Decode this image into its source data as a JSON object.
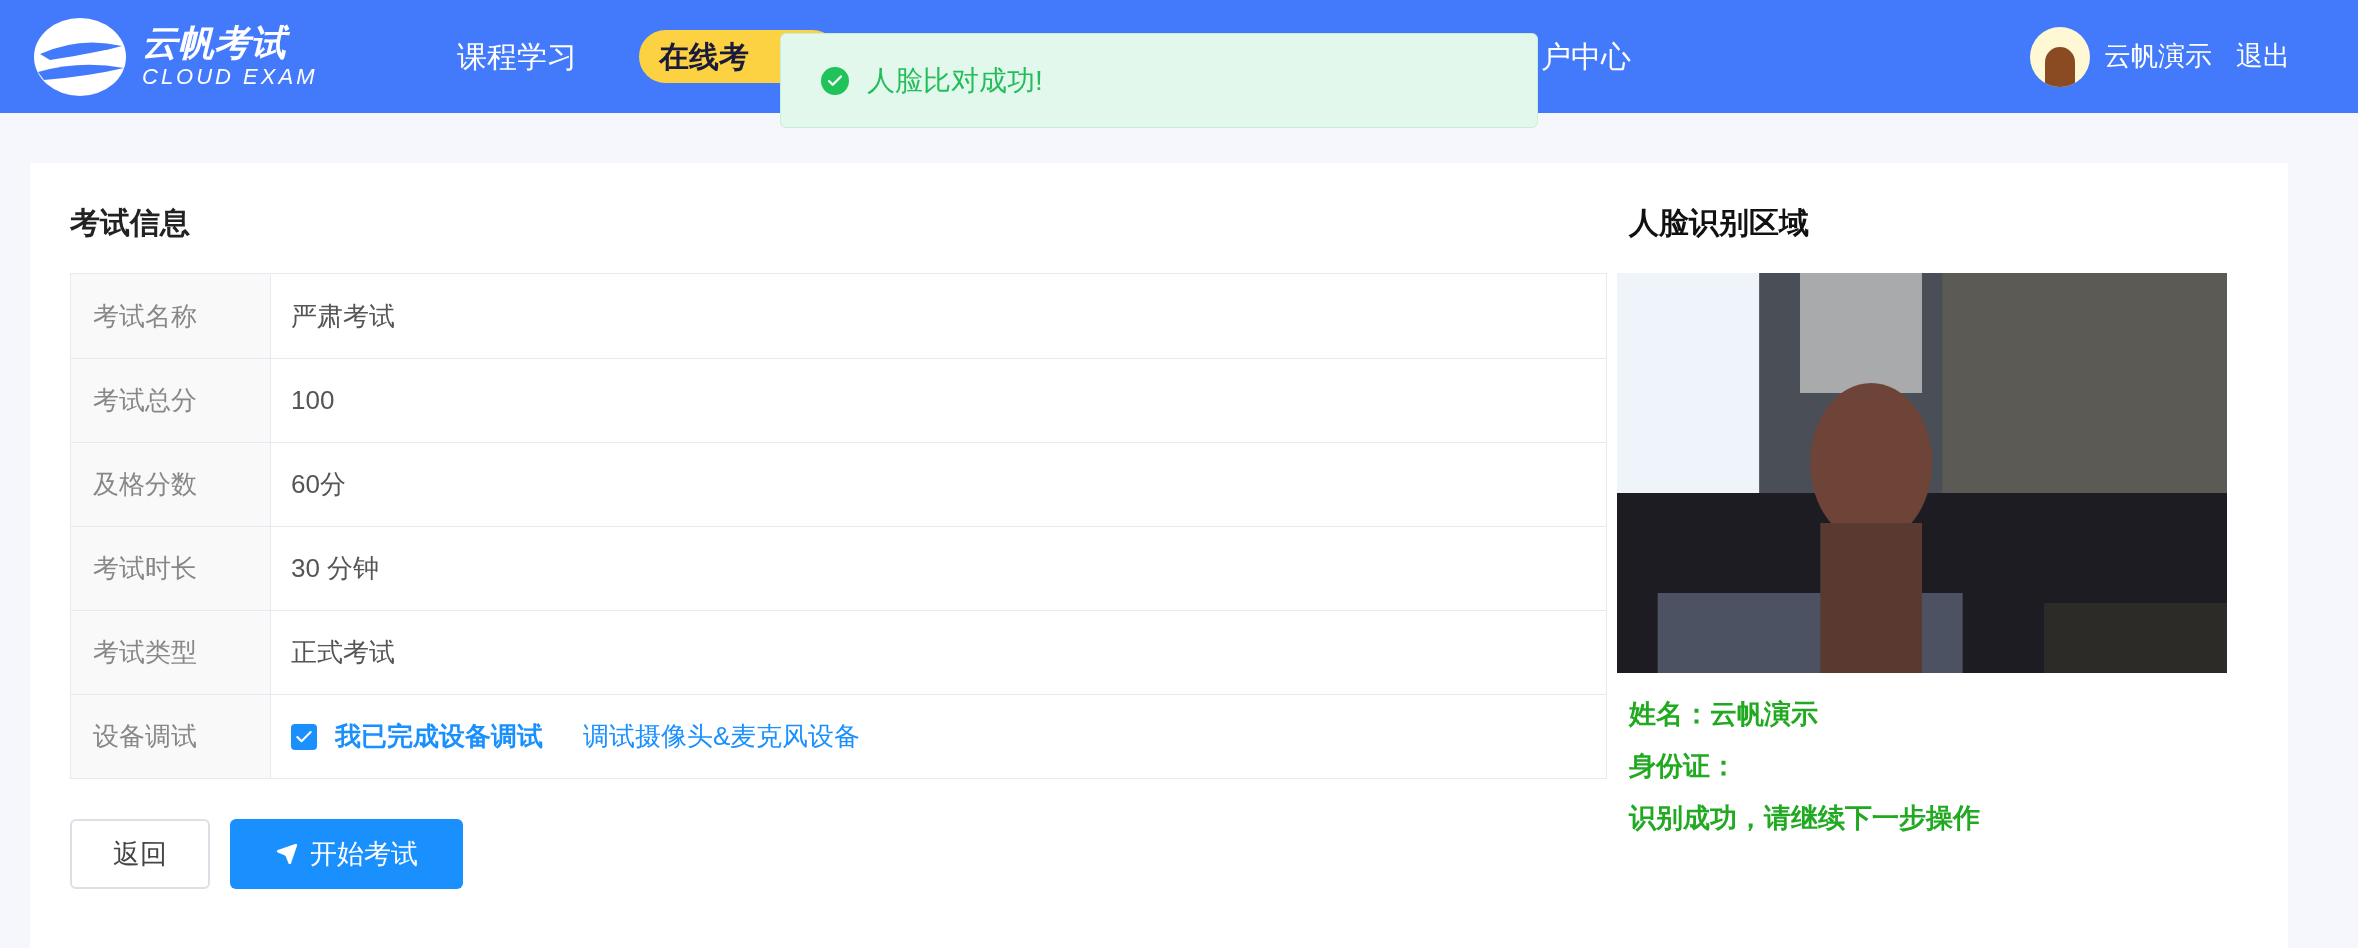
{
  "header": {
    "logo": {
      "title": "云帆考试",
      "subtitle": "CLOUD EXAM"
    },
    "nav": [
      {
        "label": "课程学习",
        "selected": false
      },
      {
        "label": "在线考",
        "selected": true
      },
      {
        "label": "户中心",
        "selected": false
      }
    ],
    "user": {
      "name": "云帆演示",
      "logout": "退出"
    }
  },
  "toast": {
    "kind": "success",
    "message": "人脸比对成功!"
  },
  "exam_info": {
    "title": "考试信息",
    "rows": [
      {
        "kind": "text",
        "label": "考试名称",
        "value": "严肃考试"
      },
      {
        "kind": "text",
        "label": "考试总分",
        "value": "100"
      },
      {
        "kind": "text",
        "label": "及格分数",
        "value": "60分"
      },
      {
        "kind": "text",
        "label": "考试时长",
        "value": "30 分钟"
      },
      {
        "kind": "text",
        "label": "考试类型",
        "value": "正式考试"
      },
      {
        "kind": "device",
        "label": "设备调试",
        "checkbox": {
          "label": "我已完成设备调试",
          "checked": true
        },
        "link": "调试摄像头&麦克风设备"
      }
    ],
    "buttons": [
      {
        "kind": "default",
        "label": "返回"
      },
      {
        "kind": "primary",
        "label": "开始考试"
      }
    ]
  },
  "face_area": {
    "title": "人脸识别区域",
    "lines": [
      "姓名：云帆演示",
      "身份证：",
      "识别成功，请继续下一步操作"
    ]
  }
}
